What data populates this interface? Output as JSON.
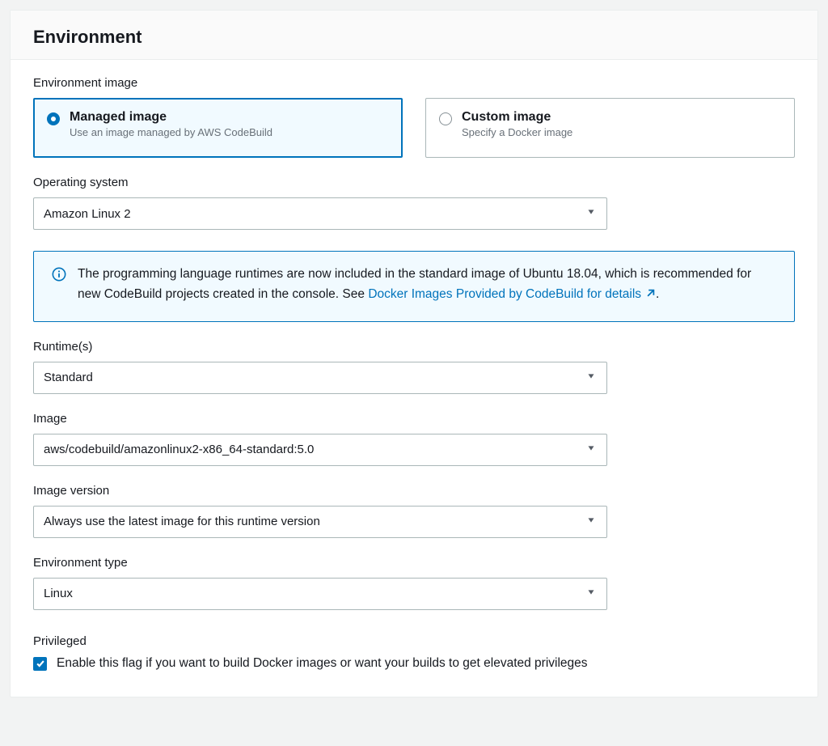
{
  "panel": {
    "title": "Environment"
  },
  "env_image": {
    "label": "Environment image",
    "options": [
      {
        "title": "Managed image",
        "desc": "Use an image managed by AWS CodeBuild",
        "selected": true
      },
      {
        "title": "Custom image",
        "desc": "Specify a Docker image",
        "selected": false
      }
    ]
  },
  "os": {
    "label": "Operating system",
    "value": "Amazon Linux 2"
  },
  "info": {
    "text_before_link": "The programming language runtimes are now included in the standard image of Ubuntu 18.04, which is recommended for new CodeBuild projects created in the console. See ",
    "link_text": "Docker Images Provided by CodeBuild for details",
    "text_after_link": "."
  },
  "runtime": {
    "label": "Runtime(s)",
    "value": "Standard"
  },
  "image": {
    "label": "Image",
    "value": "aws/codebuild/amazonlinux2-x86_64-standard:5.0"
  },
  "image_version": {
    "label": "Image version",
    "value": "Always use the latest image for this runtime version"
  },
  "env_type": {
    "label": "Environment type",
    "value": "Linux"
  },
  "privileged": {
    "label": "Privileged",
    "desc": "Enable this flag if you want to build Docker images or want your builds to get elevated privileges",
    "checked": true
  }
}
